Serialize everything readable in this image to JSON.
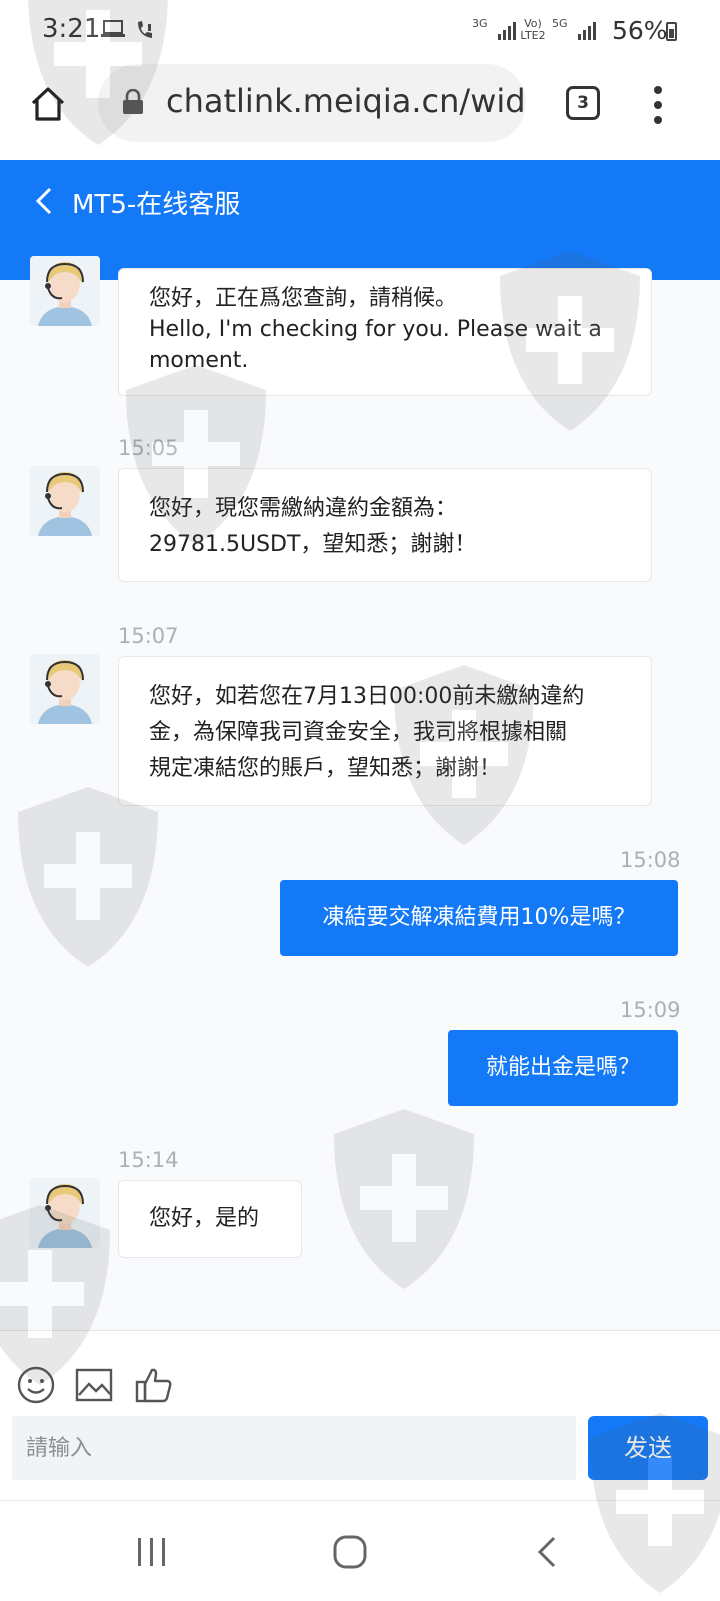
{
  "status_bar": {
    "time": "3:21",
    "network_left": "3G",
    "network_mid": "Vo) LTE2",
    "network_right": "5G",
    "battery": "56%"
  },
  "browser": {
    "url": "chatlink.meiqia.cn/wid",
    "tab_count": "3"
  },
  "header": {
    "title": "MT5-在线客服"
  },
  "messages": [
    {
      "side": "in",
      "text_line1": "您好，正在爲您查詢，請稍候。",
      "text_line2": "Hello, I'm checking for you. Please wait a",
      "text_line3": "moment."
    },
    {
      "side": "in",
      "time": "15:05",
      "text_line1": "您好，現您需繳納違約金額為：",
      "text_line2": "29781.5USDT，望知悉；謝謝！"
    },
    {
      "side": "in",
      "time": "15:07",
      "text_line1": "您好，如若您在7月13日00:00前未繳納違約",
      "text_line2": "金，為保障我司資金安全，我司將根據相關",
      "text_line3": "規定凍結您的賬戶，望知悉；謝謝！"
    },
    {
      "side": "out",
      "time": "15:08",
      "text": "凍結要交解凍結費用10%是嗎？"
    },
    {
      "side": "out",
      "time": "15:09",
      "text": "就能出金是嗎？"
    },
    {
      "side": "in",
      "time": "15:14",
      "text": "您好，是的"
    }
  ],
  "composer": {
    "placeholder": "請输入",
    "send_label": "发送"
  },
  "colors": {
    "brand": "#1479f7",
    "chat_bg": "#f9fafc"
  }
}
